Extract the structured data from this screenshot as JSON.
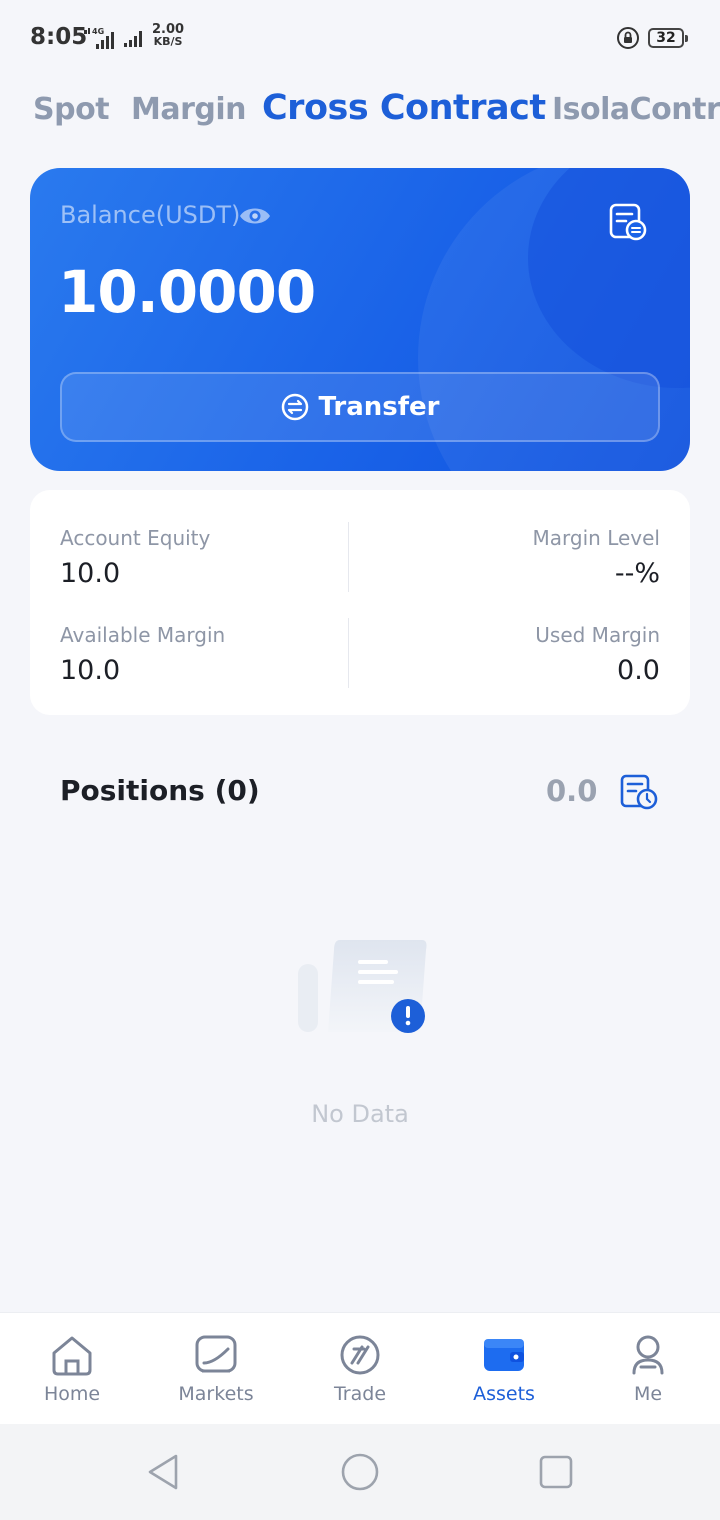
{
  "status_bar": {
    "time": "8:05",
    "network": "4G",
    "speed_value": "2.00",
    "speed_unit": "KB/S",
    "battery": "32"
  },
  "tabs": [
    {
      "label": "Spot",
      "active": false
    },
    {
      "label": "Margin",
      "active": false
    },
    {
      "label": "Cross Contract",
      "active": true
    },
    {
      "label": "IsolaContract",
      "active": false
    }
  ],
  "balance_card": {
    "label": "Balance(USDT)",
    "value": "10.0000",
    "transfer_label": "Transfer",
    "accent": "#1a63e8"
  },
  "stats": {
    "account_equity_label": "Account Equity",
    "account_equity_value": "10.0",
    "margin_level_label": "Margin Level",
    "margin_level_value": "--%",
    "available_margin_label": "Available Margin",
    "available_margin_value": "10.0",
    "used_margin_label": "Used Margin",
    "used_margin_value": "0.0"
  },
  "positions": {
    "title": "Positions (0)",
    "value": "0.0",
    "empty_text": "No Data"
  },
  "bottom_nav": [
    {
      "label": "Home",
      "icon": "home-icon",
      "active": false
    },
    {
      "label": "Markets",
      "icon": "markets-icon",
      "active": false
    },
    {
      "label": "Trade",
      "icon": "trade-icon",
      "active": false
    },
    {
      "label": "Assets",
      "icon": "wallet-icon",
      "active": true
    },
    {
      "label": "Me",
      "icon": "profile-icon",
      "active": false
    }
  ]
}
